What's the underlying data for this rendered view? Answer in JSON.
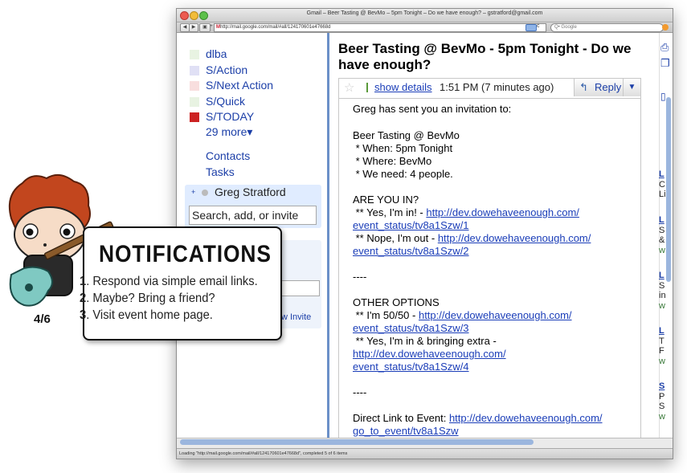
{
  "browser": {
    "window_title": "Gmail – Beer Tasting @ BevMo – 5pm Tonight – Do we have enough? – gstratford@gmail.com",
    "url": "http://mail.google.com/mail/#all/124170601e47668d",
    "search_placeholder": "Q• Google",
    "status": "Loading \"http://mail.google.com/mail/#all/124170601e47668d\", completed 5 of 6 items"
  },
  "sidebar": {
    "labels": [
      {
        "name": "dlba",
        "color": "#e8f3e2"
      },
      {
        "name": "S/Action",
        "color": "#e0e0f5"
      },
      {
        "name": "S/Next Action",
        "color": "#f8dede"
      },
      {
        "name": "S/Quick",
        "color": "#e8f3e2"
      },
      {
        "name": "S/TODAY",
        "color": "#cc2222"
      }
    ],
    "more_labels": "29 more▾",
    "contacts": "Contacts",
    "tasks": "Tasks",
    "chat_user": "Greg Stratford",
    "chat_search_value": "Search, add, or invite",
    "invite_link": "w Invite"
  },
  "email": {
    "subject": "Beer Tasting @ BevMo - 5pm Tonight - Do we have enough?",
    "show_details": "show details",
    "time": "1:51 PM (7 minutes ago)",
    "reply": "Reply",
    "more": "▼",
    "body": {
      "intro": "Greg has sent you an invitation to:",
      "event_name": "Beer Tasting @ BevMo",
      "when": " * When: 5pm Tonight",
      "where": " * Where: BevMo",
      "need": " * We need: 4 people.",
      "are_you_in": "ARE YOU IN?",
      "yes_prefix": " ** Yes, I'm in! - ",
      "yes_link_1": "http://dev.dowehaveenough.com/",
      "yes_link_2": "event_status/tv8a1Szw/1",
      "nope_prefix": " ** Nope, I'm out - ",
      "nope_link_1": "http://dev.dowehaveenough.com/",
      "nope_link_2": "event_status/tv8a1Szw/2",
      "sep_1": "----",
      "other_options": "OTHER OPTIONS",
      "maybe_prefix": " ** I'm 50/50 - ",
      "maybe_link_1": "http://dev.dowehaveenough.com/",
      "maybe_link_2": "event_status/tv8a1Szw/3",
      "extra_prefix": " ** Yes, I'm in & bringing extra -",
      "extra_link_1": "http://dev.dowehaveenough.com/",
      "extra_link_2": "event_status/tv8a1Szw/4",
      "sep_2": "----",
      "direct_prefix": "Direct Link to Event: ",
      "direct_link_1": "http://dev.dowehaveenough.com/",
      "direct_link_2": "go_to_event/tv8a1Szw"
    }
  },
  "right_column": {
    "lines": [
      "L",
      "C",
      "Li",
      "L",
      "S",
      "&",
      "w",
      "L",
      "S",
      "in",
      "w",
      "L",
      "T",
      "F",
      "w",
      "S",
      "P",
      "S",
      "w"
    ]
  },
  "notification": {
    "title": "NOTIFICATIONS",
    "items": [
      {
        "num": "1",
        "text": ". Respond via simple email links."
      },
      {
        "num": "2",
        "text": ". Maybe? Bring a friend?"
      },
      {
        "num": "3",
        "text": ". Visit event home page."
      }
    ],
    "counter": "4/6"
  }
}
